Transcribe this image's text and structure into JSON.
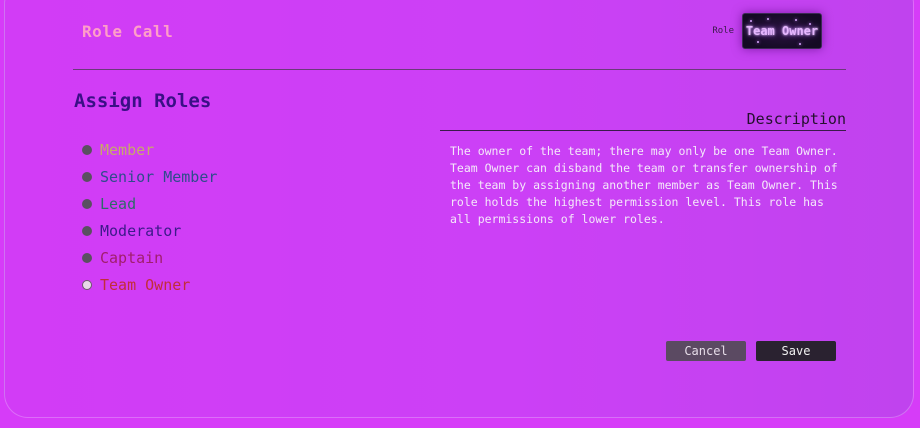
{
  "header": {
    "title": "Role Call",
    "role_caption": "Role",
    "role_badge": "Team Owner"
  },
  "main": {
    "section_title": "Assign Roles",
    "roles": [
      {
        "label": "Member",
        "color": "#c8a86a",
        "selected": false
      },
      {
        "label": "Senior Member",
        "color": "#2f4c8c",
        "selected": false
      },
      {
        "label": "Lead",
        "color": "#2f6a6a",
        "selected": false
      },
      {
        "label": "Moderator",
        "color": "#3c1a8a",
        "selected": false
      },
      {
        "label": "Captain",
        "color": "#a01e6c",
        "selected": false
      },
      {
        "label": "Team Owner",
        "color": "#c22e3a",
        "selected": true
      }
    ]
  },
  "description": {
    "heading": "Description",
    "body": "The owner of the team; there may only be one Team Owner. Team Owner can disband the team or transfer ownership of the team by assigning another member as Team Owner. This role holds the highest permission level. This role has all permissions of lower roles."
  },
  "actions": {
    "cancel_label": "Cancel",
    "save_label": "Save"
  }
}
